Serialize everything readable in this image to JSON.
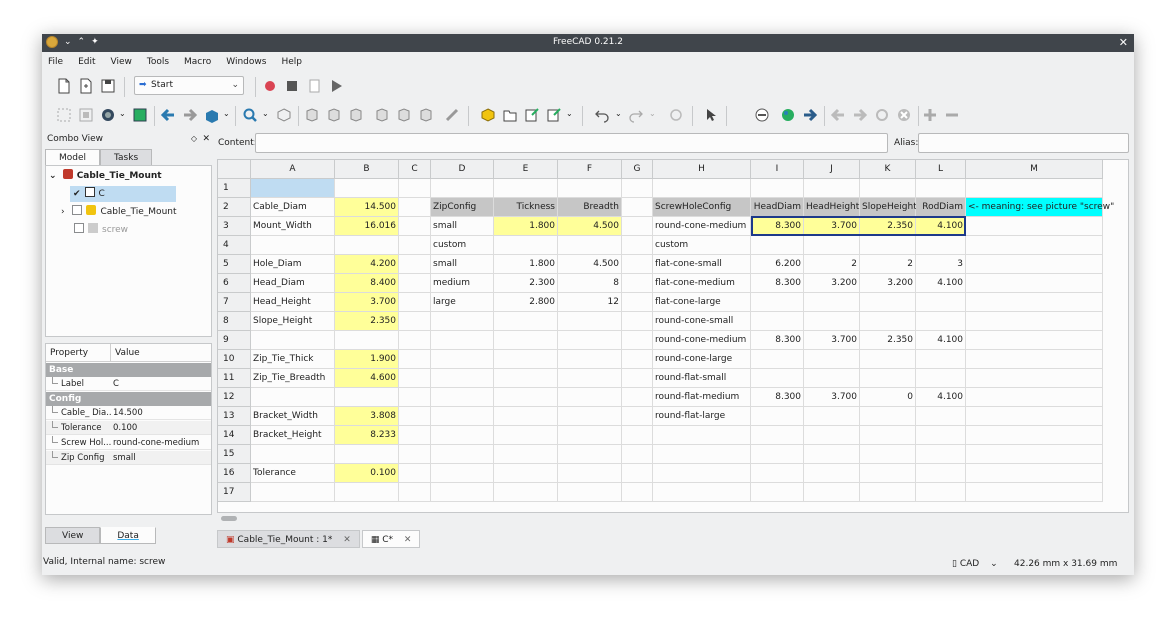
{
  "window": {
    "title": "FreeCAD 0.21.2"
  },
  "menu": [
    "File",
    "Edit",
    "View",
    "Tools",
    "Macro",
    "Windows",
    "Help"
  ],
  "toolbar": {
    "workbench": "Start"
  },
  "combo_view": {
    "title": "Combo View",
    "tabs": [
      "Model",
      "Tasks"
    ],
    "tree": [
      {
        "label": "Cable_Tie_Mount",
        "level": 0
      },
      {
        "label": "C",
        "level": 1
      },
      {
        "label": "Cable_Tie_Mount",
        "level": 1
      },
      {
        "label": "screw",
        "level": 1
      }
    ],
    "props_header": [
      "Property",
      "Value"
    ],
    "groups": [
      {
        "name": "Base",
        "rows": [
          {
            "name": "Label",
            "value": "C"
          }
        ]
      },
      {
        "name": "Config",
        "rows": [
          {
            "name": "Cable_ Dia...",
            "value": "14.500"
          },
          {
            "name": "Tolerance",
            "value": "0.100"
          },
          {
            "name": "Screw Hol...",
            "value": "round-cone-medium"
          },
          {
            "name": "Zip Config",
            "value": "small"
          }
        ]
      }
    ],
    "bottom_tabs": [
      "View",
      "Data"
    ]
  },
  "content_label": "Content:",
  "alias_label": "Alias:",
  "columns": [
    "A",
    "B",
    "C",
    "D",
    "E",
    "F",
    "G",
    "H",
    "I",
    "J",
    "K",
    "L",
    "M"
  ],
  "rows": [
    "1",
    "2",
    "3",
    "4",
    "5",
    "6",
    "7",
    "8",
    "9",
    "10",
    "11",
    "12",
    "13",
    "14",
    "15",
    "16",
    "17"
  ],
  "cells": {
    "A2": "Cable_Diam",
    "B2": "14.500",
    "D2": "ZipConfig",
    "E2": "Tickness",
    "F2": "Breadth",
    "H2": "ScrewHoleConfig",
    "I2": "HeadDiam",
    "J2": "HeadHeight",
    "K2": "SlopeHeight",
    "L2": "RodDiam",
    "M2": "<- meaning: see picture \"screw\"",
    "A3": "Mount_Width",
    "B3": "16.016",
    "D3": "small",
    "E3": "1.800",
    "F3": "4.500",
    "H3": "round-cone-medium",
    "I3": "8.300",
    "J3": "3.700",
    "K3": "2.350",
    "L3": "4.100",
    "D4": "custom",
    "H4": "custom",
    "A5": "Hole_Diam",
    "B5": "4.200",
    "D5": "small",
    "E5": "1.800",
    "F5": "4.500",
    "H5": "flat-cone-small",
    "I5": "6.200",
    "J5": "2",
    "K5": "2",
    "L5": "3",
    "A6": "Head_Diam",
    "B6": "8.400",
    "D6": "medium",
    "E6": "2.300",
    "F6": "8",
    "H6": "flat-cone-medium",
    "I6": "8.300",
    "J6": "3.200",
    "K6": "3.200",
    "L6": "4.100",
    "A7": "Head_Height",
    "B7": "3.700",
    "D7": "large",
    "E7": "2.800",
    "F7": "12",
    "H7": "flat-cone-large",
    "A8": "Slope_Height",
    "B8": "2.350",
    "H8": "round-cone-small",
    "H9": "round-cone-medium",
    "I9": "8.300",
    "J9": "3.700",
    "K9": "2.350",
    "L9": "4.100",
    "A10": "Zip_Tie_Thick",
    "B10": "1.900",
    "H10": "round-cone-large",
    "A11": "Zip_Tie_Breadth",
    "B11": "4.600",
    "H11": "round-flat-small",
    "H12": "round-flat-medium",
    "I12": "8.300",
    "J12": "3.700",
    "K12": "0",
    "L12": "4.100",
    "A13": "Bracket_Width",
    "B13": "3.808",
    "H13": "round-flat-large",
    "A14": "Bracket_Height",
    "B14": "8.233",
    "A16": "Tolerance",
    "B16": "0.100"
  },
  "doc_tabs": [
    {
      "label": "Cable_Tie_Mount : 1*"
    },
    {
      "label": "C*"
    }
  ],
  "status": {
    "text": "Valid, Internal name: screw",
    "nav": "CAD",
    "dims": "42.26 mm x 31.69 mm"
  },
  "colors": {
    "yellow": "#ffff99",
    "gray_header": "#c6c6c6",
    "cyan": "#00ffff",
    "selected": "#bfdcf2"
  }
}
